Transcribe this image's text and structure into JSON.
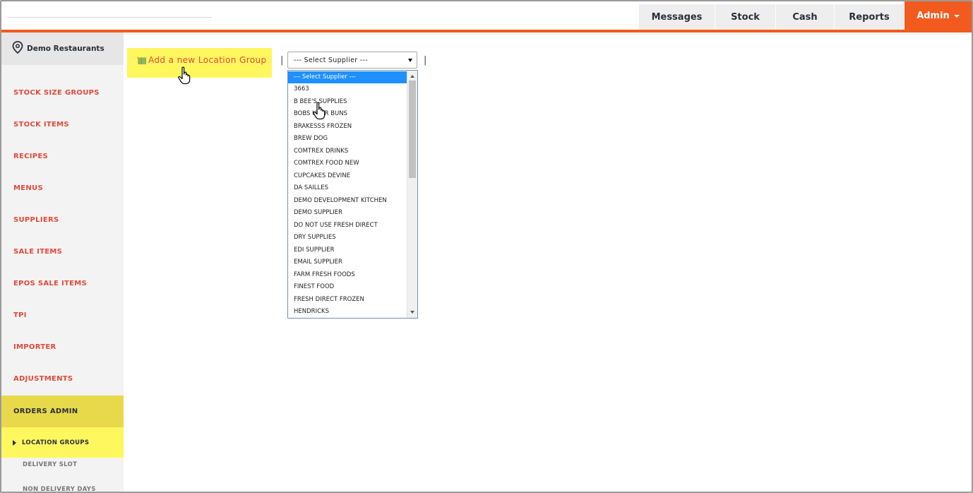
{
  "topnav": {
    "tabs": [
      "Messages",
      "Stock",
      "Cash",
      "Reports"
    ],
    "admin_label": "Admin",
    "accent": "#f35a1d"
  },
  "sidebar": {
    "org_name": "Demo Restaurants",
    "items": [
      {
        "label": "STOCK SIZE GROUPS"
      },
      {
        "label": "STOCK ITEMS"
      },
      {
        "label": "RECIPES"
      },
      {
        "label": "MENUS"
      },
      {
        "label": "SUPPLIERS"
      },
      {
        "label": "SALE ITEMS"
      },
      {
        "label": "EPOS SALE ITEMS"
      },
      {
        "label": "TPI"
      },
      {
        "label": "IMPORTER"
      },
      {
        "label": "ADJUSTMENTS"
      },
      {
        "label": "ORDERS ADMIN"
      }
    ],
    "sub_items": [
      {
        "label": "LOCATION GROUPS"
      },
      {
        "label": "DELIVERY SLOT"
      },
      {
        "label": "NON DELIVERY DAYS"
      }
    ],
    "highlight": "#fff75e"
  },
  "content": {
    "add_label": "Add a new Location Group",
    "separator": "|",
    "supplier_select": {
      "value": "--- Select Supplier ---",
      "options": [
        "--- Select Supplier ---",
        "3663",
        "B BEE'S SUPPLIES",
        "BOBS UBER BUNS",
        "BRAKESSS FROZEN",
        "BREW DOG",
        "COMTREX DRINKS",
        "COMTREX FOOD NEW",
        "CUPCAKES DEVINE",
        "DA SAILLES",
        "DEMO DEVELOPMENT KITCHEN",
        "DEMO SUPPLIER",
        "DO NOT USE FRESH DIRECT",
        "DRY SUPPLIES",
        "EDI SUPPLIER",
        "EMAIL SUPPLIER",
        "FARM FRESH FOODS",
        "FINEST FOOD",
        "FRESH DIRECT FROZEN",
        "HENDRICKS"
      ]
    }
  }
}
